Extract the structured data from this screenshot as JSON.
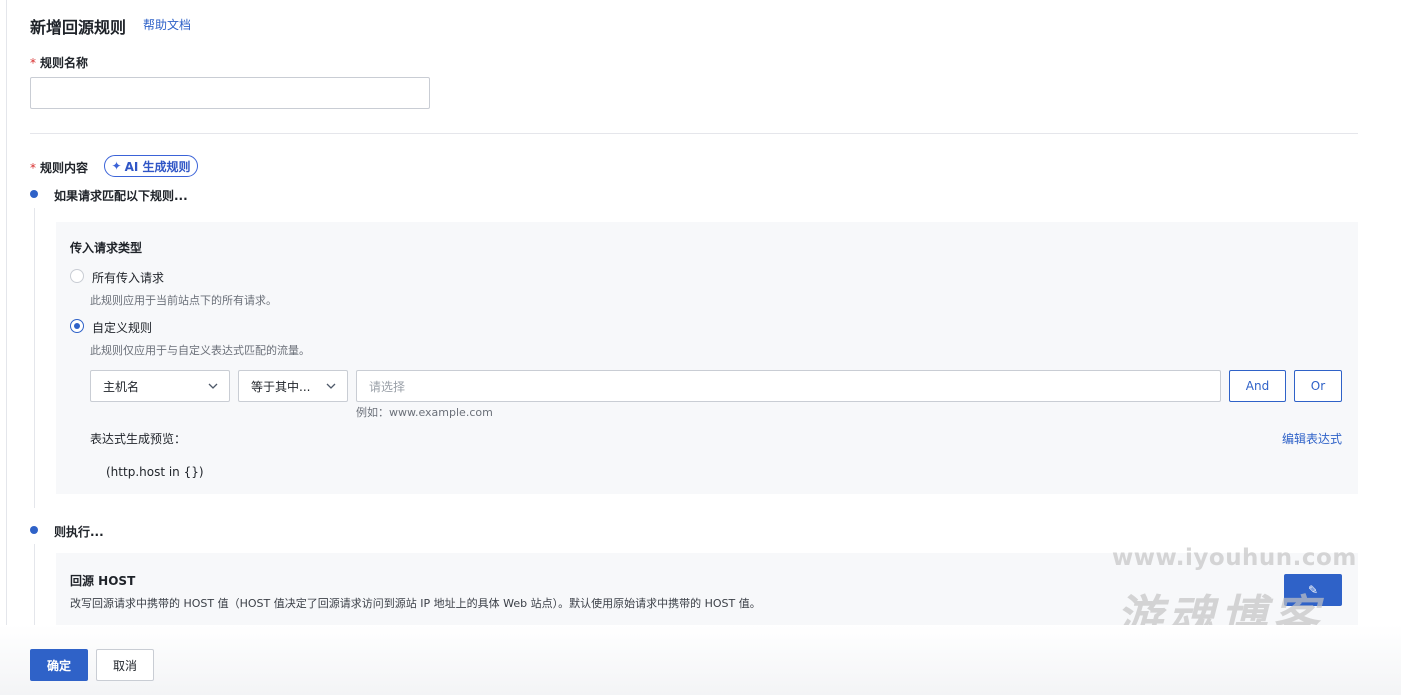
{
  "header": {
    "title": "新增回源规则",
    "help_link": "帮助文档"
  },
  "form": {
    "rule_name": {
      "label": "规则名称",
      "value": "",
      "placeholder": ""
    },
    "rule_content": {
      "label": "规则内容",
      "ai_button": "AI 生成规则"
    }
  },
  "if_step": {
    "title": "如果请求匹配以下规则...",
    "incoming_type_title": "传入请求类型",
    "options": [
      {
        "label": "所有传入请求",
        "desc": "此规则应用于当前站点下的所有请求。",
        "selected": false
      },
      {
        "label": "自定义规则",
        "desc": "此规则仅应用于与自定义表达式匹配的流量。",
        "selected": true
      }
    ],
    "condition": {
      "field": "主机名",
      "operator": "等于其中...",
      "value_placeholder": "请选择",
      "example": "例如：www.example.com",
      "and_label": "And",
      "or_label": "Or"
    },
    "preview_label": "表达式生成预览：",
    "edit_link": "编辑表达式",
    "expression": "(http.host in {})"
  },
  "then_step": {
    "title": "则执行...",
    "host_title": "回源 HOST",
    "host_desc": "改写回源请求中携带的 HOST 值（HOST 值决定了回源请求访问到源站 IP 地址上的具体 Web 站点）。默认使用原始请求中携带的 HOST 值。"
  },
  "watermark": {
    "url": "www.iyouhun.com",
    "name": "游魂博客"
  },
  "footer": {
    "confirm": "确定",
    "cancel": "取消"
  },
  "colors": {
    "primary": "#2f62c8",
    "required": "#d8302f",
    "panel_bg": "#f7f8fa"
  }
}
